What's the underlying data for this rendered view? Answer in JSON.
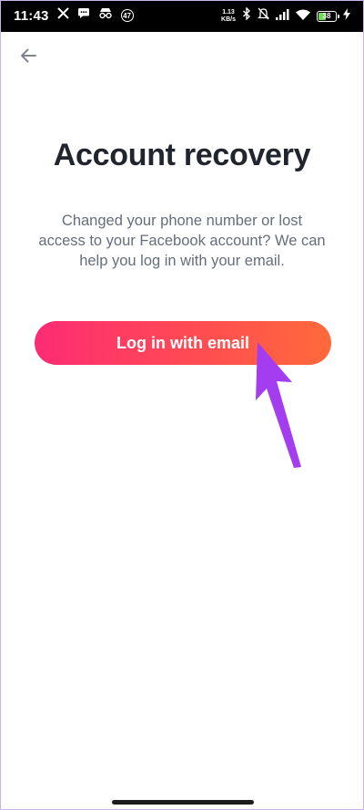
{
  "status_bar": {
    "time": "11:43",
    "notification_count": "47",
    "net_speed_value": "1.13",
    "net_speed_unit": "KB/s",
    "battery_level": "38"
  },
  "icons": {
    "x": "x-logo-icon",
    "message": "message-icon",
    "incognito": "incognito-icon",
    "bluetooth": "bluetooth-icon",
    "mute": "bell-off-icon",
    "signal": "signal-icon",
    "wifi": "wifi-icon",
    "charging": "charging-bolt-icon",
    "back": "back-arrow-icon"
  },
  "header": {
    "title": "Account recovery"
  },
  "body": {
    "description_lines": [
      "Changed your phone number or lost",
      "access to your Facebook account? We can",
      "help you log in with your email."
    ]
  },
  "actions": {
    "login_email_label": "Log in with email"
  },
  "colors": {
    "gradient_start": "#fd2b74",
    "gradient_end": "#ff6a3a",
    "annotation_arrow": "#a43cf0",
    "title": "#21262e",
    "description": "#656e7b"
  }
}
